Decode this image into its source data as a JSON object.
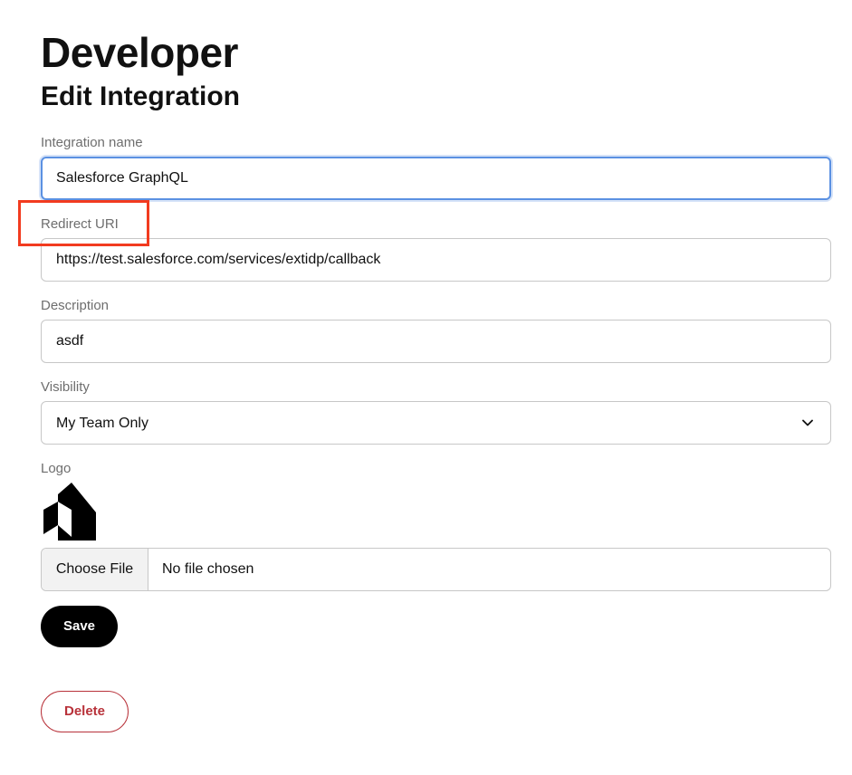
{
  "page": {
    "title": "Developer",
    "subtitle": "Edit Integration"
  },
  "form": {
    "integration_name": {
      "label": "Integration name",
      "value": "Salesforce GraphQL"
    },
    "redirect_uri": {
      "label": "Redirect URI",
      "value": "https://test.salesforce.com/services/extidp/callback"
    },
    "description": {
      "label": "Description",
      "value": "asdf"
    },
    "visibility": {
      "label": "Visibility",
      "selected": "My Team Only",
      "icon": "chevron-down-icon"
    },
    "logo": {
      "label": "Logo",
      "icon": "house-logo-icon",
      "file_button_label": "Choose File",
      "file_status": "No file chosen"
    }
  },
  "actions": {
    "save_label": "Save",
    "delete_label": "Delete"
  },
  "colors": {
    "focus_border": "#5b91e2",
    "primary_button": "#000000",
    "danger": "#b8323a",
    "highlight": "#f23b1f"
  }
}
